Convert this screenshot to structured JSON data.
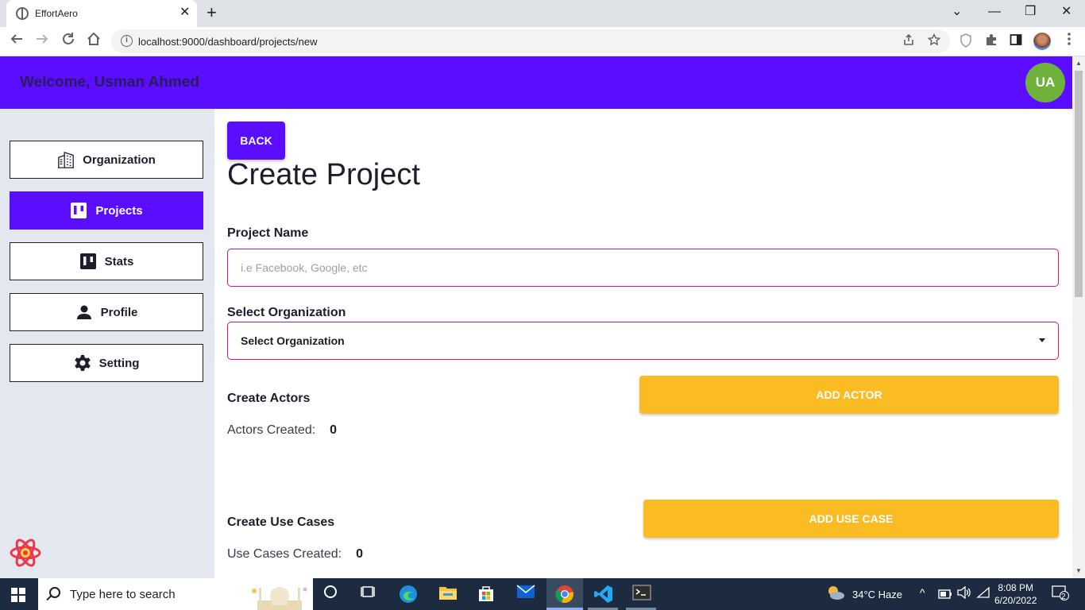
{
  "browser": {
    "tab_title": "EffortAero",
    "tab_close": "✕",
    "new_tab": "+",
    "url": "localhost:9000/dashboard/projects/new",
    "window_controls": {
      "dropdown": "⌄",
      "minimize": "—",
      "restore": "❐",
      "close": "✕"
    }
  },
  "header": {
    "welcome": "Welcome, Usman Ahmed",
    "avatar_initials": "UA"
  },
  "sidebar": {
    "items": [
      {
        "label": "Organization",
        "icon": "building-icon",
        "active": false
      },
      {
        "label": "Projects",
        "icon": "board-icon",
        "active": true
      },
      {
        "label": "Stats",
        "icon": "stats-icon",
        "active": false
      },
      {
        "label": "Profile",
        "icon": "person-icon",
        "active": false
      },
      {
        "label": "Setting",
        "icon": "gear-icon",
        "active": false
      }
    ]
  },
  "main": {
    "back_label": "BACK",
    "title": "Create Project",
    "project_name_label": "Project Name",
    "project_name_placeholder": "i.e Facebook, Google, etc",
    "project_name_value": "",
    "organization_label": "Select Organization",
    "organization_selected": "Select Organization",
    "actors_heading": "Create Actors",
    "add_actor_label": "ADD ACTOR",
    "actors_created_label": "Actors Created:",
    "actors_created_count": "0",
    "use_cases_heading": "Create Use Cases",
    "add_use_case_label": "ADD USE CASE",
    "use_cases_created_label": "Use Cases Created:",
    "use_cases_created_count": "0"
  },
  "taskbar": {
    "search_placeholder": "Type here to search",
    "weather": "34°C  Haze",
    "time": "8:08 PM",
    "date": "6/20/2022",
    "notifications": "2"
  },
  "colors": {
    "primary": "#5b0eff",
    "accent": "#fbbb22",
    "input_border": "#c8178f",
    "avatar": "#6fb23a",
    "sidebar_bg": "#e3e8f0"
  }
}
